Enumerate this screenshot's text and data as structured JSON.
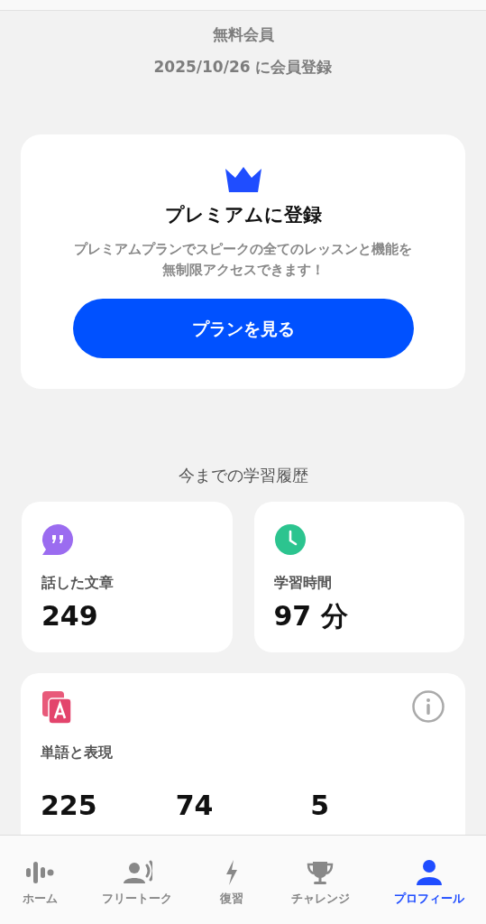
{
  "membership": {
    "plan": "無料会員",
    "registered": "2025/10/26 に会員登録"
  },
  "premium_card": {
    "title": "プレミアムに登録",
    "description": "プレミアムプランでスピークの全てのレッスンと機能を無制限アクセスできます！",
    "button": "プランを見る"
  },
  "history": {
    "title": "今までの学習履歴",
    "stats": [
      {
        "kind": "speech",
        "color": "#9b6cf0",
        "label": "話した文章",
        "value": "249"
      },
      {
        "kind": "clock",
        "color": "#2cc48f",
        "label": "学習時間",
        "value": "97 分"
      }
    ],
    "vocabulary": {
      "label": "単語と表現",
      "counts": [
        "225",
        "74",
        "5"
      ]
    }
  },
  "tab_bar": [
    {
      "kind": "wave",
      "label": "ホーム",
      "selected": false
    },
    {
      "kind": "talk",
      "label": "フリートーク",
      "selected": false
    },
    {
      "kind": "bolt",
      "label": "復習",
      "selected": false
    },
    {
      "kind": "trophy",
      "label": "チャレンジ",
      "selected": false
    },
    {
      "kind": "person",
      "label": "プロフィール",
      "selected": true
    }
  ]
}
